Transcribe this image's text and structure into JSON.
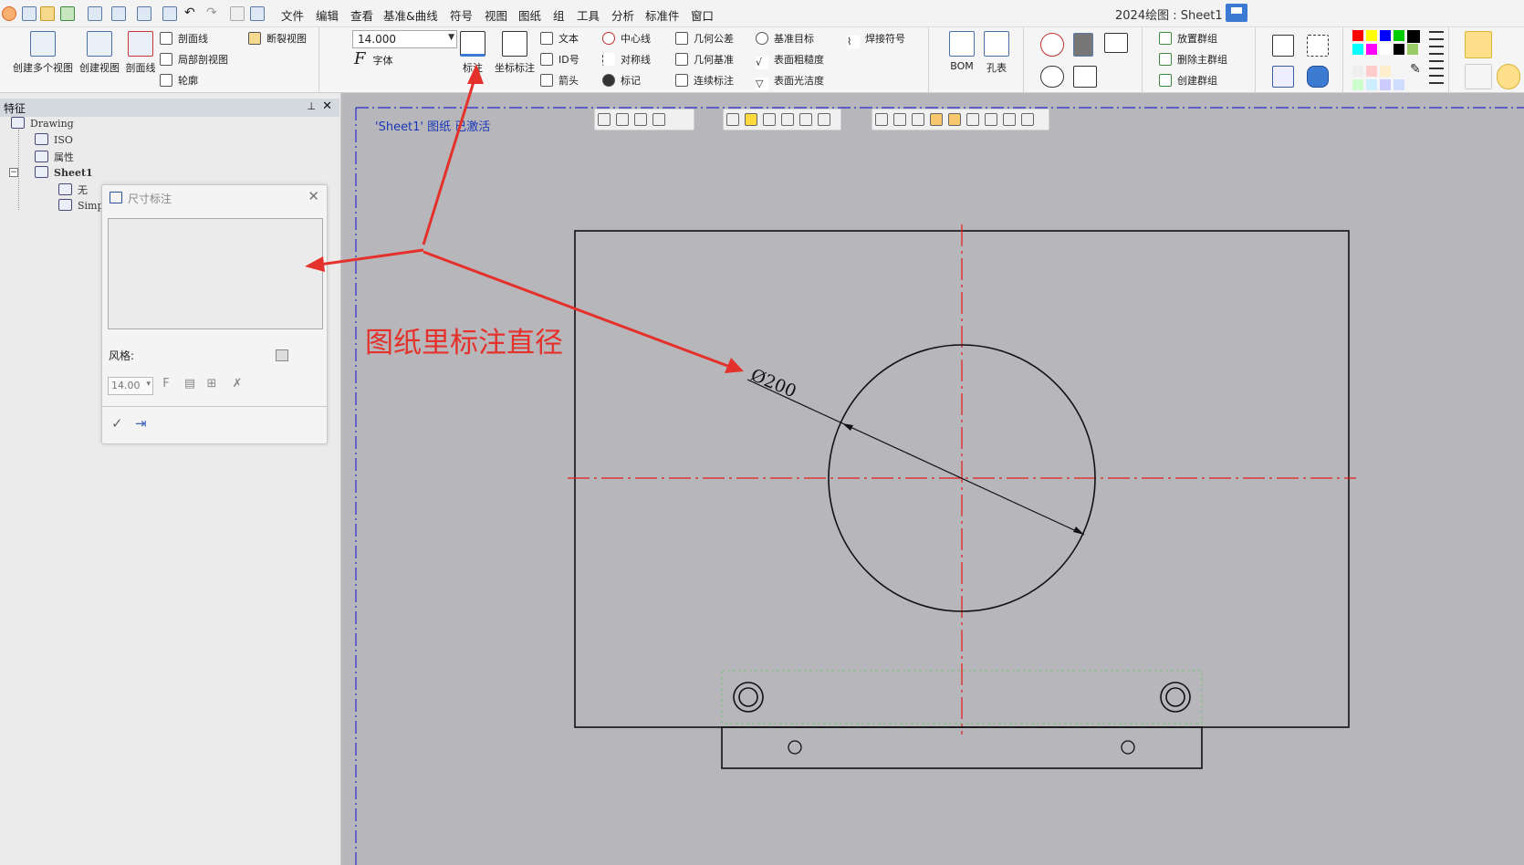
{
  "app": {
    "title": "2024绘图 : Sheet1"
  },
  "menu": [
    "文件",
    "编辑",
    "查看",
    "基准&曲线",
    "符号",
    "视图",
    "图纸",
    "组",
    "工具",
    "分析",
    "标准件",
    "窗口"
  ],
  "ribbon": {
    "views": {
      "create_multi": "创建多个视图",
      "create_view": "创建视图",
      "section_line": "剖面线",
      "section_view": "剖面线",
      "partial_section": "局部剖视图",
      "outline": "轮廓",
      "break_view": "断裂视图"
    },
    "font_size": "14.000",
    "font": "字体",
    "dimension": "标注",
    "coord_dimension": "坐标标注",
    "annotation": {
      "text": "文本",
      "id": "ID号",
      "arrow": "箭头",
      "center_line": "中心线",
      "symmetry_line": "对称线",
      "mark": "标记",
      "geo_tolerance": "几何公差",
      "geo_datum": "几何基准",
      "continuous_dim": "连续标注",
      "datum_target": "基准目标",
      "surface_roughness": "表面粗糙度",
      "surface_finish": "表面光洁度",
      "weld_symbol": "焊接符号"
    },
    "bom": "BOM",
    "hole_table": "孔表",
    "groups": {
      "place": "放置群组",
      "delete_main": "删除主群组",
      "create": "创建群组"
    }
  },
  "feature_panel": {
    "title": "特征",
    "pin": "ꟷ",
    "close": "✕",
    "tree": [
      {
        "label": "Drawing"
      },
      {
        "label": "ISO"
      },
      {
        "label": "属性"
      },
      {
        "label": "Sheet1"
      },
      {
        "label": "无"
      },
      {
        "label": "Simp"
      }
    ]
  },
  "dim_dialog": {
    "title": "尺寸标注",
    "style_label": "风格:",
    "size": "14.00"
  },
  "canvas": {
    "status": "'Sheet1' 图纸 已激活",
    "annotation": "图纸里标注直径",
    "diameter_label": "Ø200"
  },
  "colors": {
    "annotation_red": "#e4312b",
    "centerline_red": "#e41b1b",
    "status_blue": "#1a37b7",
    "hole_green": "#7ec27e"
  },
  "icons": [
    "save-icon",
    "open-icon",
    "undo-icon",
    "redo-icon",
    "pin-icon",
    "close-icon",
    "select-icon",
    "bulb-icon",
    "rotate-icon"
  ]
}
